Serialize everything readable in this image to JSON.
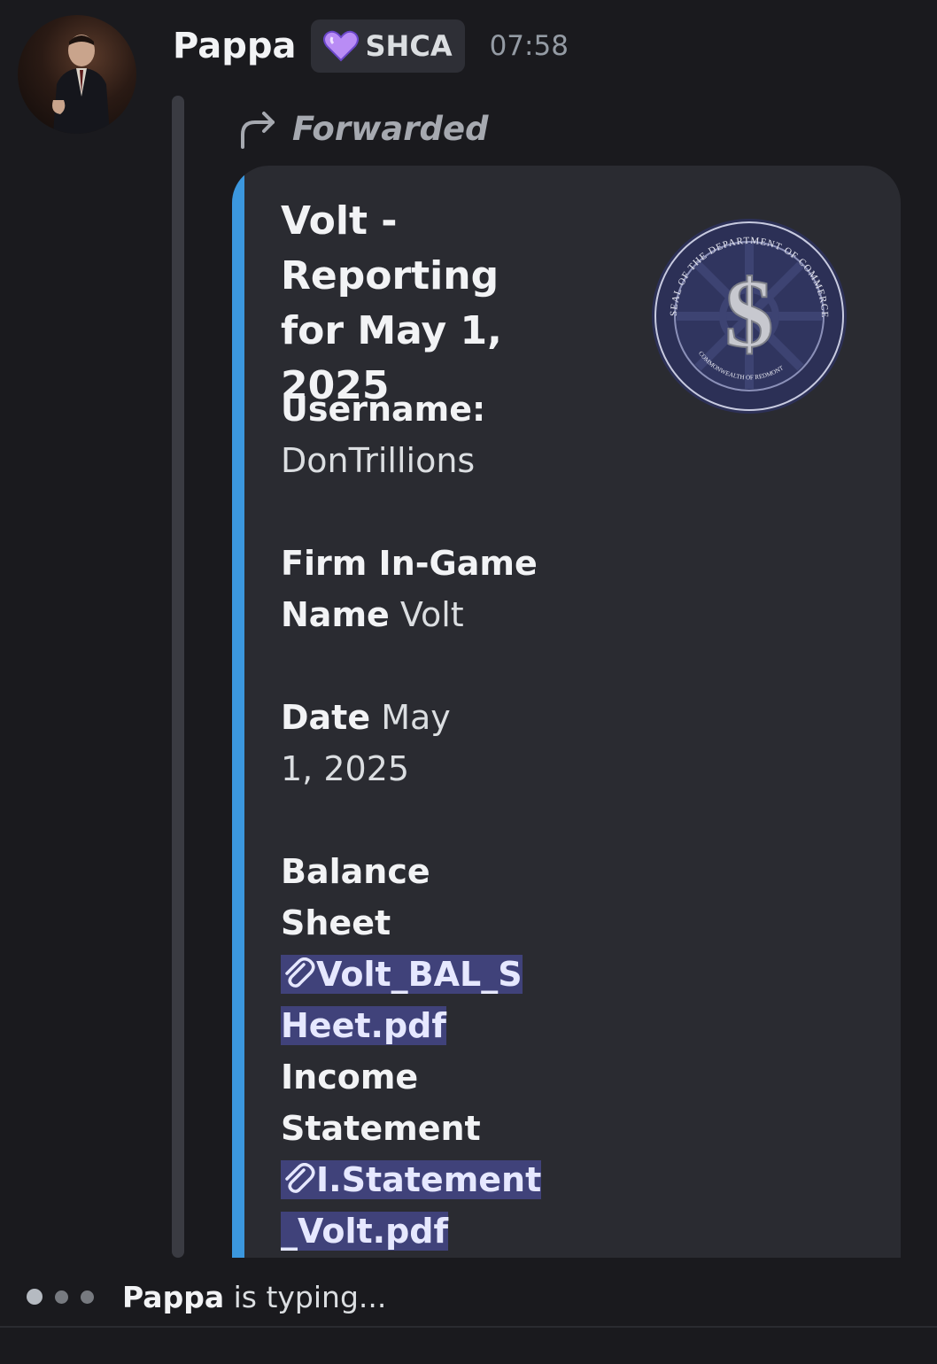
{
  "message": {
    "author": "Pappa",
    "tag": "SHCA",
    "timestamp": "07:58",
    "forwarded_label": "Forwarded"
  },
  "embed": {
    "title": "Volt - Reporting for May 1, 2025",
    "accent_color": "#3b97de",
    "thumbnail": {
      "top_text": "SEAL OF THE DEPARTMENT OF COMMERCE",
      "bottom_text": "COMMONWEALTH OF REDMONT",
      "symbol": "$"
    },
    "fields": {
      "username": {
        "name": "Username:",
        "value": "DonTrillions"
      },
      "firm": {
        "name": "Firm In-Game Name",
        "value": "Volt"
      },
      "date": {
        "name": "Date",
        "value": "May 1, 2025"
      },
      "balance": {
        "name": "Balance Sheet",
        "value": "Volt_BAL_SHeet.pdf"
      },
      "income": {
        "name": "Income Statement",
        "value": "I.Statement_Volt.pdf"
      }
    }
  },
  "typing": {
    "user": "Pappa",
    "text": "is typing..."
  }
}
